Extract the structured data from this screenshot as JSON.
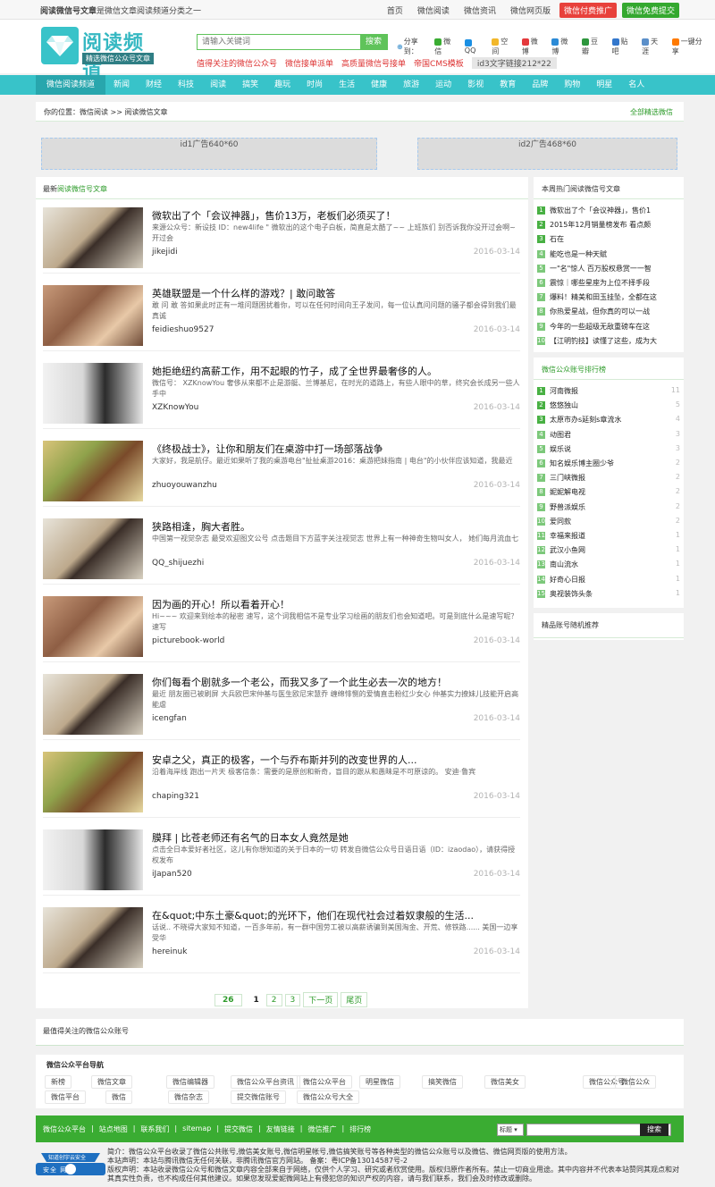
{
  "topbar": {
    "slogan_bold": "阅读微信号文章",
    "slogan_rest": "是微信文章阅读频道分类之一",
    "links": [
      "首页",
      "微信阅读",
      "微信资讯",
      "微信网页版"
    ],
    "btn_paid": "微信付费推广",
    "btn_free": "微信免费提交"
  },
  "header": {
    "logo_title": "阅读频道",
    "logo_sub": "精选微信公众号文章",
    "search_placeholder": "请输入关键词",
    "search_button": "搜索",
    "share_label": "分享到：",
    "share_items": [
      "微信",
      "QQ",
      "空间",
      "微博",
      "微博",
      "豆瓣",
      "贴吧",
      "天涯",
      "一键分享"
    ],
    "hot_links": [
      "值得关注的微信公众号",
      "微信接单派单",
      "高质量微信号接单",
      "帝国CMS模板"
    ],
    "hot_gray": "id3文字链接212*22"
  },
  "nav": [
    "微信阅读频道",
    "新闻",
    "财经",
    "科技",
    "阅读",
    "搞笑",
    "趣玩",
    "时尚",
    "生活",
    "健康",
    "旅游",
    "运动",
    "影视",
    "教育",
    "品牌",
    "购物",
    "明星",
    "名人"
  ],
  "breadcrumb": {
    "text": "你的位置：微信阅读 >> 阅读微信文章",
    "right": "全部精选微信"
  },
  "ads": {
    "ad1": "id1广告640*60",
    "ad2": "id2广告468*60"
  },
  "main": {
    "heading_prefix": "最新",
    "heading_green": "阅读微信号文章",
    "articles": [
      {
        "title": "微软出了个「会议神器」，售价13万，老板们必须买了！",
        "desc": "来源公众号：新设技 ID：new4life \" 微软出的这个电子白板，简直是太酷了~~ 上班族们 别否诉我你没开过会啊~ 开过会",
        "author": "jikejidi",
        "date": "2016-03-14"
      },
      {
        "title": "英雄联盟是一个什么样的游戏？| 敢问敢答",
        "desc": "敢 问 敢 答如果此时正有一堆问题困扰着你，可以在任何时间向王子发问，每一位认真问问题的骚子都会得到我们最真诚",
        "author": "feidieshuo9527",
        "date": "2016-03-14"
      },
      {
        "title": "她拒绝纽约高薪工作，用不起眼的竹子，成了全世界最奢侈的人。",
        "desc": "微信号： XZKnowYou 奢侈从来都不止是游艇、兰博基尼，在时光的道路上，有些人眼中的草，终究会长成另一些人手中",
        "author": "XZKnowYou",
        "date": "2016-03-14"
      },
      {
        "title": "《终极战士》，让你和朋友们在桌游中打一场部落战争",
        "desc": "大家好，我是航仔。最近如果听了我的桌游电台\"扯扯桌游2016：桌游把妹指南 | 电台\"的小伙伴应该知道，我最近",
        "author": "zhuoyouwanzhu",
        "date": "2016-03-14"
      },
      {
        "title": "狭路相逢，胸大者胜。",
        "desc": "中国第一视觉杂志 最受欢迎图文公号 点击题目下方蓝字关注视觉志 世界上有一种神奇生物叫女人， 她们每月流血七",
        "author": "QQ_shijuezhi",
        "date": "2016-03-14"
      },
      {
        "title": "因为画的开心！所以看着开心！",
        "desc": "Hi~~~ 欢迎来到绘本的秘密 速写，这个词我相信不是专业学习绘画的朋友们也会知道吧。可是到底什么是速写呢？速写",
        "author": "picturebook-world",
        "date": "2016-03-14"
      },
      {
        "title": "你们每看个剧就多一个老公，而我又多了一个此生必去一次的地方！",
        "desc": "最近 朋友圈已被刷屏 大兵欧巴宋仲基与医生欧尼宋慧乔 缠绵悱恻的爱情直击粉红少女心 仲基实力撩妹儿技能开启高能虐",
        "author": "icengfan",
        "date": "2016-03-14"
      },
      {
        "title": "安卓之父，真正的极客，一个与乔布斯并列的改变世界的人...",
        "desc": "沿着海岸线 跑出一片天 极客信条：需要的是原创和新奇，盲目的跟从和愚昧是不可原谅的。 安迪·鲁宾",
        "author": "chaping321",
        "date": "2016-03-14"
      },
      {
        "title": "膜拜 | 比苍老师还有名气的日本女人竟然是她",
        "desc": "点击全日本爱好者社区，这儿有你想知道的关于日本的一切 转发自微信公众号日语日语（ID：izaodao），请获得授权发布",
        "author": "iJapan520",
        "date": "2016-03-14"
      },
      {
        "title": "在&quot;中东土豪&quot;的光环下，他们在现代社会过着奴隶般的生活...",
        "desc": "话说.. 不晓得大家知不知道，一百多年前，有一群中国劳工被以高薪诱骗到美国淘金、开荒、修铁路...... 美国一边享受华",
        "author": "hereinuk",
        "date": "2016-03-14"
      }
    ],
    "pager": {
      "total": "26",
      "pages": [
        "1",
        "2",
        "3"
      ],
      "next": "下一页",
      "last": "尾页"
    }
  },
  "side_hot": {
    "title": "本周热门阅读微信号文章",
    "items": [
      "微软出了个「会议神器」，售价1",
      "2015年12月销量榜发布 看点颇",
      "石在",
      "能吃也是一种天赋",
      "一\"名\"惊人 百万股权悬赏一一智",
      "震惊｜哪些星座为上位不择手段",
      "爆料！精美和田玉挂坠，全都在这",
      "你热爱星战，但你真的可以一战",
      "今年的一些超级无敌重磅车在这",
      "【江明钓技】读懂了这些，成为大"
    ]
  },
  "side_rank": {
    "title": "微信公众账号排行榜",
    "items": [
      {
        "name": "河南微报",
        "count": "11"
      },
      {
        "name": "悠悠独山",
        "count": "5"
      },
      {
        "name": "太原市办s延刻s章流水",
        "count": "4"
      },
      {
        "name": "动图君",
        "count": "3"
      },
      {
        "name": "娱乐说",
        "count": "3"
      },
      {
        "name": "知名娱乐博主圈少爷",
        "count": "2"
      },
      {
        "name": "三门峡微报",
        "count": "2"
      },
      {
        "name": "妮妮解电视",
        "count": "2"
      },
      {
        "name": "野兽派娱乐",
        "count": "2"
      },
      {
        "name": "爱同款",
        "count": "2"
      },
      {
        "name": "幸福来报道",
        "count": "1"
      },
      {
        "name": "武汉小鱼网",
        "count": "1"
      },
      {
        "name": "南山流水",
        "count": "1"
      },
      {
        "name": "好奇心日报",
        "count": "1"
      },
      {
        "name": "奥视装饰头条",
        "count": "1"
      }
    ]
  },
  "side_random": {
    "title": "精品账号随机推荐"
  },
  "follow": {
    "title": "最值得关注的微信公众账号"
  },
  "platform": {
    "title": "微信公众平台导航",
    "row1": [
      "新榜",
      "微信文章",
      "微信编辑器",
      "微信公众平台资讯",
      "微信公众平台",
      "明星微信",
      "搞笑微信",
      "微信美女",
      "微信公众号",
      "微信公众"
    ],
    "row2": [
      "微信平台",
      "微信",
      "微信杂志",
      "提交微信账号",
      "微信公众号大全"
    ]
  },
  "footnav": {
    "links": [
      "微信公众平台",
      "|",
      "站点地图",
      "|",
      "联系我们",
      "|",
      "sitemap",
      "|",
      "提交微信",
      "|",
      "友情链接",
      "|",
      "微信推广",
      "|",
      "排行榜"
    ],
    "select": "标题",
    "search": "搜索"
  },
  "footer": {
    "line1": "简介：微信公众平台收录了微信公共账号,微信美女账号,微信明星帐号,微信搞笑账号等各种类型的微信公众账号以及微信、微信网页版的使用方法。",
    "line2": "本站声明：本站与腾讯微信无任何关联，非腾讯微信官方网站。 备案：粤ICP备13014587号-2",
    "line3": "版权声明：本站收录微信公众号和微信文章内容全部来自于网络，仅供个人学习、研究或者欣赏使用。版权归原作者所有。禁止一切商业用途。其中内容并不代表本站赞同其观点和对其真实性负责，也不构成任何其他建议。如果您发现爱妮微网站上有侵犯您的知识产权的内容，请与我们联系，我们会及时修改或删除。",
    "badge_top": "知道创宇云安全",
    "badge_bottom": "安全 网站"
  },
  "colors": {
    "accent": "#38c3c9",
    "green": "#3aac32",
    "red": "#e8413b"
  }
}
